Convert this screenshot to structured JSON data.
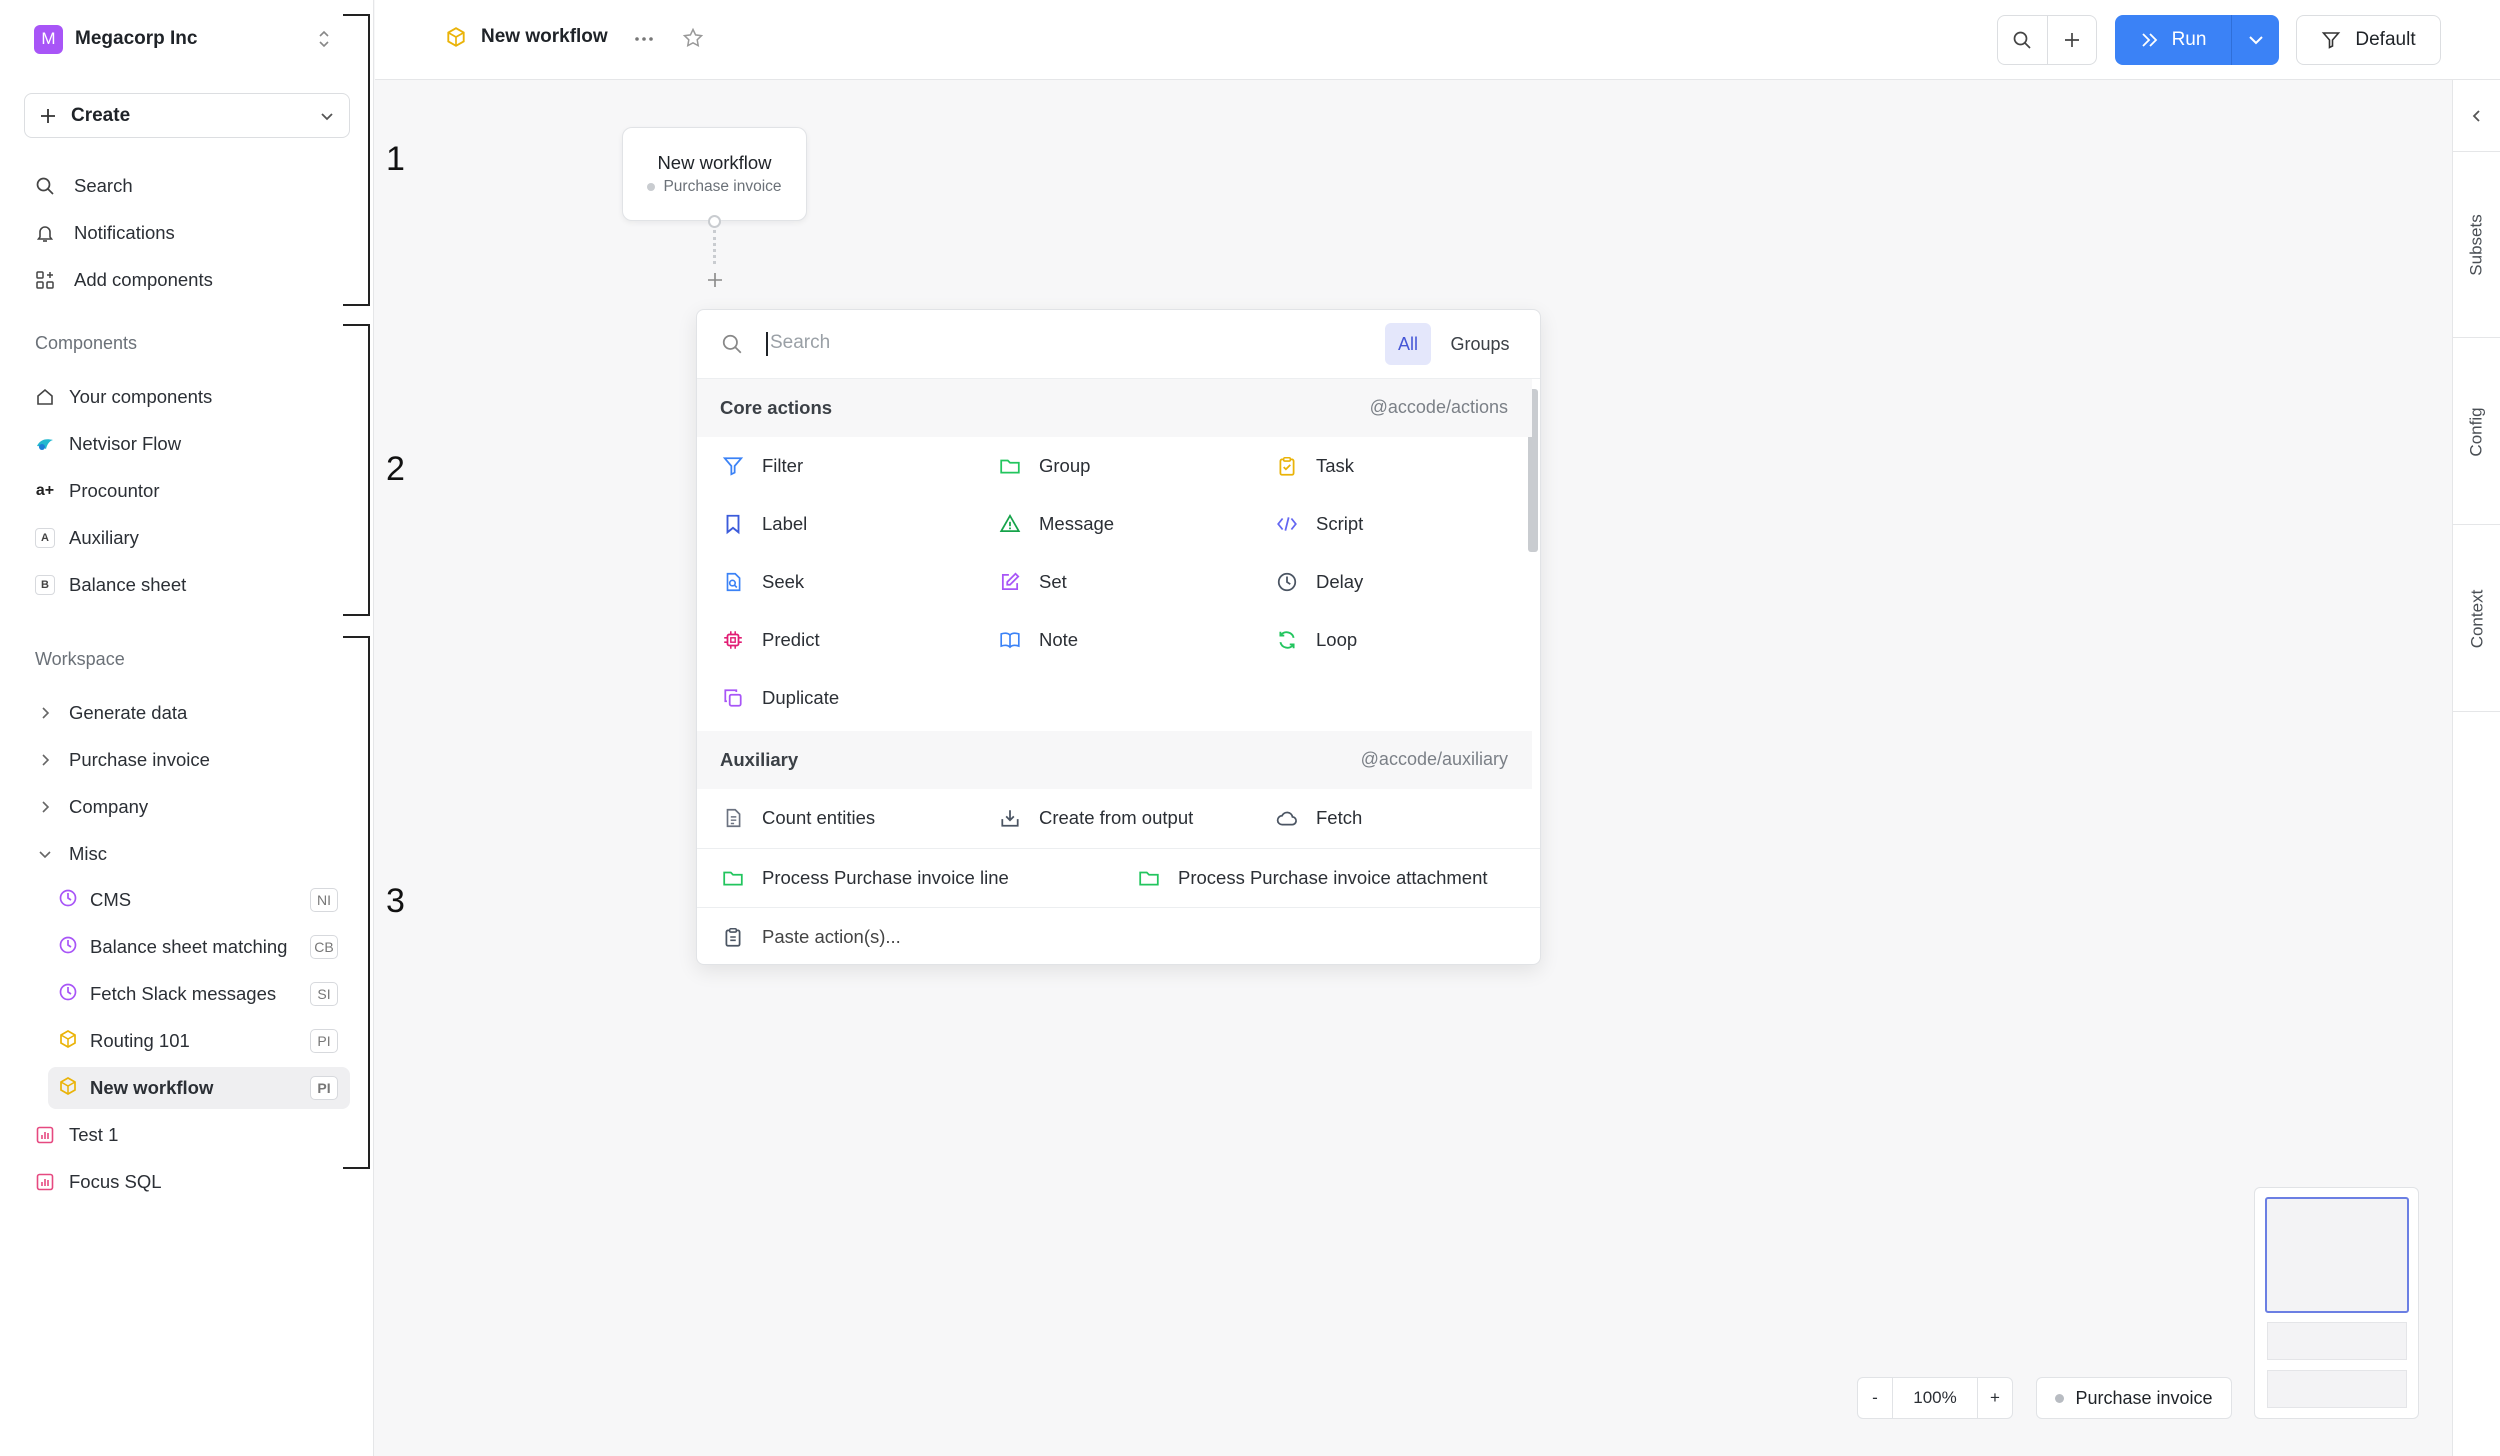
{
  "sidebar": {
    "org": {
      "initial": "M",
      "name": "Megacorp Inc"
    },
    "create_label": "Create",
    "nav": [
      {
        "label": "Search",
        "icon": "search-icon"
      },
      {
        "label": "Notifications",
        "icon": "bell-icon"
      },
      {
        "label": "Add components",
        "icon": "grid-plus-icon"
      }
    ],
    "components_title": "Components",
    "components": [
      {
        "label": "Your components",
        "icon": "home-icon"
      },
      {
        "label": "Netvisor Flow",
        "icon": "netvisor-logo-icon"
      },
      {
        "label": "Procountor",
        "icon": "procountor-logo-icon",
        "glyph": "a+"
      },
      {
        "label": "Auxiliary",
        "icon": "letter-a-icon",
        "glyph": "A"
      },
      {
        "label": "Balance sheet",
        "icon": "letter-b-icon",
        "glyph": "B"
      }
    ],
    "workspace_title": "Workspace",
    "workspace": [
      {
        "label": "Generate data"
      },
      {
        "label": "Purchase invoice"
      },
      {
        "label": "Company"
      },
      {
        "label": "Misc"
      }
    ],
    "misc_items": [
      {
        "label": "CMS",
        "badge": "NI",
        "icon": "clock-icon"
      },
      {
        "label": "Balance sheet matching",
        "badge": "CB",
        "icon": "clock-icon"
      },
      {
        "label": "Fetch Slack messages",
        "badge": "SI",
        "icon": "clock-icon"
      },
      {
        "label": "Routing 101",
        "badge": "PI",
        "icon": "cube-icon"
      },
      {
        "label": "New workflow",
        "badge": "PI",
        "icon": "cube-icon",
        "active": true
      }
    ],
    "reports": [
      {
        "label": "Test 1",
        "icon": "chart-icon"
      },
      {
        "label": "Focus SQL",
        "icon": "chart-icon"
      }
    ],
    "annotations": [
      "1",
      "2",
      "3"
    ]
  },
  "topbar": {
    "title": "New workflow",
    "run_label": "Run",
    "default_label": "Default"
  },
  "right_panel": {
    "tabs": [
      "Subsets",
      "Config",
      "Context"
    ]
  },
  "canvas": {
    "trigger": {
      "title": "New workflow",
      "subtitle": "Purchase invoice"
    },
    "zoom": {
      "minus": "-",
      "value": "100%",
      "plus": "+"
    },
    "context_pill": "Purchase invoice"
  },
  "picker": {
    "search_placeholder": "Search",
    "filter_all": "All",
    "filter_groups": "Groups",
    "sections": [
      {
        "name": "Core actions",
        "package": "@accode/actions",
        "items": [
          {
            "label": "Filter",
            "icon": "filter-icon",
            "color": "#3b82f6"
          },
          {
            "label": "Group",
            "icon": "folder-icon",
            "color": "#22c55e"
          },
          {
            "label": "Task",
            "icon": "clipboard-check-icon",
            "color": "#eab308"
          },
          {
            "label": "Label",
            "icon": "bookmark-icon",
            "color": "#3b5bdb"
          },
          {
            "label": "Message",
            "icon": "triangle-alert-icon",
            "color": "#16a34a"
          },
          {
            "label": "Script",
            "icon": "code-icon",
            "color": "#6366f1"
          },
          {
            "label": "Seek",
            "icon": "file-search-icon",
            "color": "#3b82f6"
          },
          {
            "label": "Set",
            "icon": "pencil-square-icon",
            "color": "#a855f7"
          },
          {
            "label": "Delay",
            "icon": "clock-icon",
            "color": "#4b5563"
          },
          {
            "label": "Predict",
            "icon": "cpu-icon",
            "color": "#e11d74"
          },
          {
            "label": "Note",
            "icon": "book-open-icon",
            "color": "#3b82f6"
          },
          {
            "label": "Loop",
            "icon": "refresh-icon",
            "color": "#22c55e"
          },
          {
            "label": "Duplicate",
            "icon": "copy-icon",
            "color": "#a855f7"
          }
        ]
      },
      {
        "name": "Auxiliary",
        "package": "@accode/auxiliary",
        "items": [
          {
            "label": "Count entities",
            "icon": "document-icon",
            "color": "#6b7280"
          },
          {
            "label": "Create from output",
            "icon": "download-box-icon",
            "color": "#4b5563"
          },
          {
            "label": "Fetch",
            "icon": "cloud-icon",
            "color": "#4b5563"
          }
        ]
      }
    ],
    "groups": [
      {
        "label": "Process Purchase invoice line",
        "icon": "folder-icon",
        "color": "#22c55e"
      },
      {
        "label": "Process Purchase invoice attachment",
        "icon": "folder-icon",
        "color": "#22c55e"
      }
    ],
    "paste_label": "Paste action(s)..."
  },
  "colors": {
    "accent": "#3b82f6",
    "active_filter_bg": "#e4e7fb",
    "org_avatar": "#a855f7"
  }
}
